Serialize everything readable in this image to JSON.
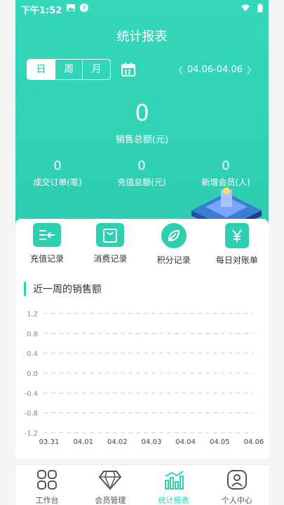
{
  "status": {
    "time": "下午1:52"
  },
  "header": {
    "title": "统计报表"
  },
  "period": {
    "tabs": [
      "日",
      "周",
      "月"
    ],
    "active": 0
  },
  "range": {
    "prev": "〈",
    "value": "04.06-04.06",
    "next": "〉"
  },
  "summary": {
    "value": "0",
    "label": "销售总额(元)"
  },
  "stats": [
    {
      "value": "0",
      "label": "成交订单(笔)"
    },
    {
      "value": "0",
      "label": "充值总额(元)"
    },
    {
      "value": "0",
      "label": "新增会员(人)"
    }
  ],
  "actions": [
    {
      "label": "充值记录",
      "icon": "recharge-icon"
    },
    {
      "label": "消费记录",
      "icon": "shopping-bag-icon"
    },
    {
      "label": "积分记录",
      "icon": "leaf-icon"
    },
    {
      "label": "每日对账单",
      "icon": "yen-icon"
    }
  ],
  "chart_section": {
    "title": "近一周的销售额"
  },
  "chart_data": {
    "type": "line",
    "title": "近一周的销售额",
    "categories": [
      "03.31",
      "04.01",
      "04.02",
      "04.03",
      "04.04",
      "04.05",
      "04.06"
    ],
    "series": [
      {
        "values": [
          0,
          0,
          0,
          0,
          0,
          0,
          0
        ]
      }
    ],
    "yticks": [
      "1.2",
      "0.8",
      "0.4",
      "0.0",
      "-0.4",
      "-0.8",
      "-1.2"
    ],
    "ylim": [
      -1.2,
      1.2
    ],
    "grid": true
  },
  "tabbar": [
    {
      "label": "工作台",
      "icon": "grid-icon"
    },
    {
      "label": "会员管理",
      "icon": "diamond-icon"
    },
    {
      "label": "统计报表",
      "icon": "bar-chart-icon"
    },
    {
      "label": "个人中心",
      "icon": "person-icon"
    }
  ],
  "tabbar_active": 2,
  "colors": {
    "primary": "#2fd0b0",
    "hero": "#34d7b9"
  }
}
